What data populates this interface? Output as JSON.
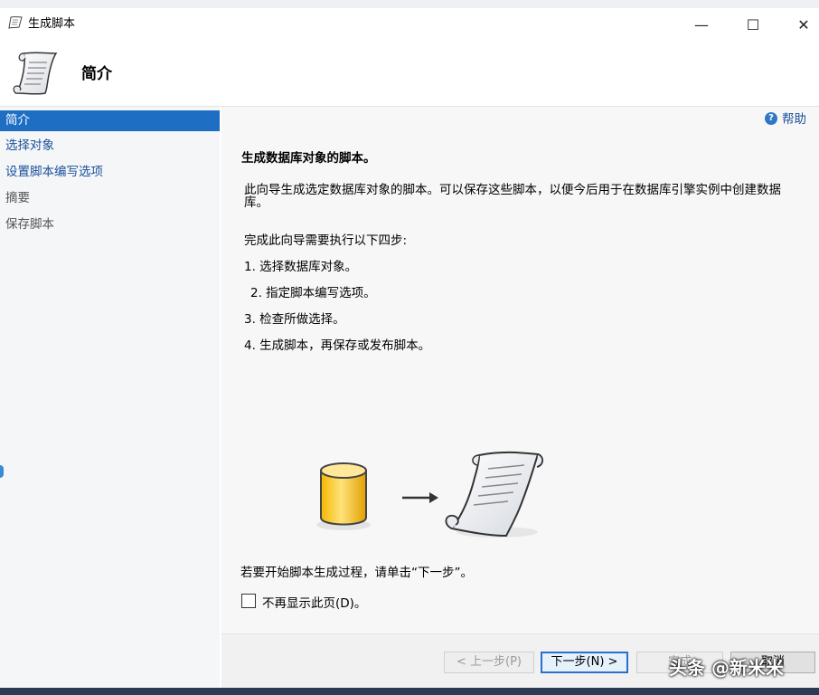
{
  "window": {
    "title": "生成脚本",
    "minimize_glyph": "—",
    "maximize_glyph": "☐",
    "close_glyph": "✕"
  },
  "header": {
    "title": "简介"
  },
  "nav": {
    "items": [
      {
        "label": "简介",
        "state": "active"
      },
      {
        "label": "选择对象",
        "state": "link"
      },
      {
        "label": "设置脚本编写选项",
        "state": "link"
      },
      {
        "label": "摘要",
        "state": "disabled"
      },
      {
        "label": "保存脚本",
        "state": "disabled"
      }
    ]
  },
  "content": {
    "help_label": "帮助",
    "heading": "生成数据库对象的脚本。",
    "description": "此向导生成选定数据库对象的脚本。可以保存这些脚本，以便今后用于在数据库引擎实例中创建数据库。",
    "steps_title": "完成此向导需要执行以下四步:",
    "steps": [
      "1. 选择数据库对象。",
      "2. 指定脚本编写选项。",
      "3. 检查所做选择。",
      "4. 生成脚本，再保存或发布脚本。"
    ],
    "start_text": "若要开始脚本生成过程，请单击“下一步”。",
    "checkbox_label": "不再显示此页(D)。",
    "checkbox_checked": false
  },
  "buttons": {
    "prev": "< 上一步(P)",
    "next": "下一步(N) >",
    "finish": "完成",
    "cancel": "取消"
  },
  "watermark": "头条 @新米米",
  "colors": {
    "accent": "#1e6fc4",
    "link": "#1a4f9a",
    "bottom_strip": "#2b3a55"
  }
}
